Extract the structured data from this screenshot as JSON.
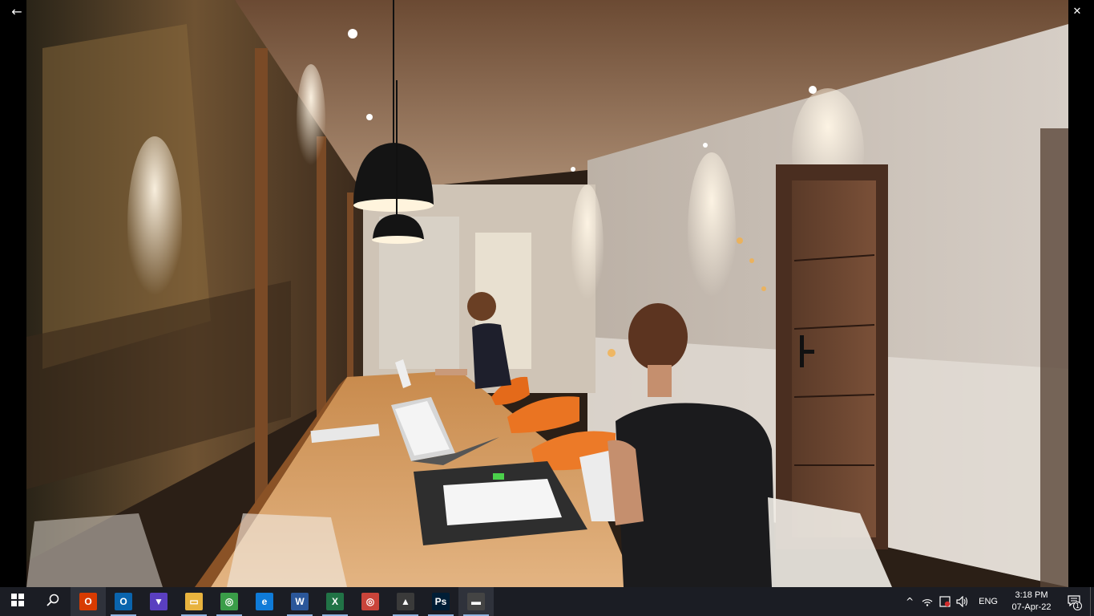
{
  "window": {
    "back_icon": "arrow-left-icon",
    "controls": [
      {
        "name": "minimize-button",
        "glyph": "─"
      },
      {
        "name": "restore-button",
        "glyph": "❐"
      },
      {
        "name": "close-button",
        "glyph": "✕"
      }
    ]
  },
  "colors": {
    "taskbar": "#1b1d24",
    "indicator": "#8fb3df",
    "office": "#d83b01",
    "word": "#2b579a",
    "excel": "#217346",
    "photoshop": "#001e36",
    "edge": "#0f7bd8"
  },
  "taskbar": {
    "start_icon": "windows-logo-icon",
    "search_icon": "search-icon",
    "apps": [
      {
        "name": "office-icon",
        "glyph": "O",
        "color": "#d83b01",
        "running": false,
        "active": true
      },
      {
        "name": "outlook-icon",
        "glyph": "O",
        "color": "#0a64ad",
        "running": true,
        "active": false
      },
      {
        "name": "brave-browser-icon",
        "glyph": "▼",
        "color": "#5a3fc0",
        "running": false,
        "active": false
      },
      {
        "name": "file-explorer-icon",
        "glyph": "▭",
        "color": "#e8b33e",
        "running": true,
        "active": false
      },
      {
        "name": "chrome-icon",
        "glyph": "◎",
        "color": "#3a9d48",
        "running": true,
        "active": false
      },
      {
        "name": "edge-icon",
        "glyph": "e",
        "color": "#0f7bd8",
        "running": false,
        "active": false
      },
      {
        "name": "word-icon",
        "glyph": "W",
        "color": "#2b579a",
        "running": true,
        "active": false
      },
      {
        "name": "excel-icon",
        "glyph": "X",
        "color": "#217346",
        "running": true,
        "active": false
      },
      {
        "name": "chrome-profile-icon",
        "glyph": "◎",
        "color": "#c9443a",
        "running": false,
        "active": false
      },
      {
        "name": "photos-icon",
        "glyph": "▲",
        "color": "#3a3a3a",
        "running": true,
        "active": false
      },
      {
        "name": "photoshop-icon",
        "glyph": "Ps",
        "color": "#001e36",
        "running": true,
        "active": false
      },
      {
        "name": "movies-tv-icon",
        "glyph": "▬",
        "color": "#444",
        "running": true,
        "active": true
      }
    ],
    "tray": {
      "chevron_icon": "chevron-up-icon",
      "network_icon": "wifi-icon",
      "security_icon": "defender-alert-icon",
      "volume_icon": "volume-icon",
      "language": "ENG",
      "time": "3:18 PM",
      "date": "07-Apr-22",
      "notification_icon": "action-center-icon",
      "notification_count": "1"
    }
  }
}
